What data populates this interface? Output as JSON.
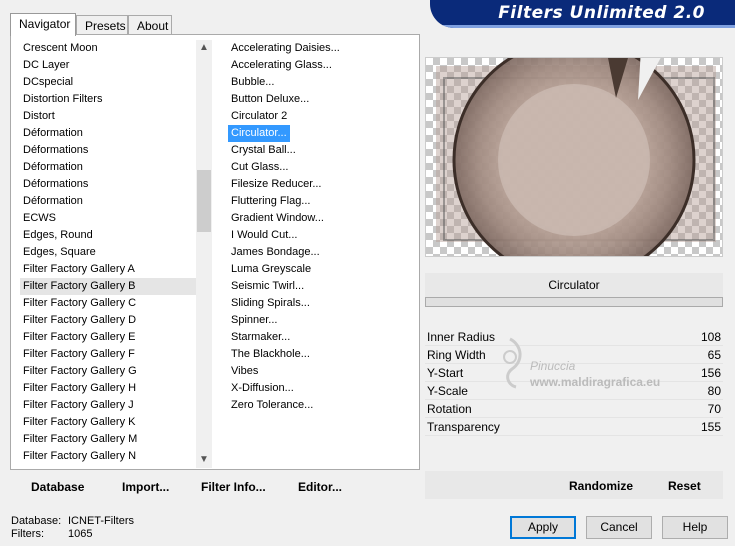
{
  "header": {
    "title": "Filters Unlimited 2.0"
  },
  "tabs": [
    {
      "label": "Navigator",
      "active": true
    },
    {
      "label": "Presets",
      "active": false
    },
    {
      "label": "About",
      "active": false
    }
  ],
  "categories": {
    "items": [
      "Crescent Moon",
      "DC Layer",
      "DCspecial",
      "Distortion Filters",
      "Distort",
      "Déformation",
      "Déformations",
      "Déformation",
      "Déformations",
      "Déformation",
      "ECWS",
      "Edges, Round",
      "Edges, Square",
      "Filter Factory Gallery A",
      "Filter Factory Gallery B",
      "Filter Factory Gallery C",
      "Filter Factory Gallery D",
      "Filter Factory Gallery E",
      "Filter Factory Gallery F",
      "Filter Factory Gallery G",
      "Filter Factory Gallery H",
      "Filter Factory Gallery J",
      "Filter Factory Gallery K",
      "Filter Factory Gallery M",
      "Filter Factory Gallery N"
    ],
    "selected": "Filter Factory Gallery B"
  },
  "filters": {
    "items": [
      "Accelerating Daisies...",
      "Accelerating Glass...",
      "Bubble...",
      "Button Deluxe...",
      "Circulator 2",
      "Circulator...",
      "Crystal Ball...",
      "Cut Glass...",
      "Filesize Reducer...",
      "Fluttering Flag...",
      "Gradient Window...",
      "I Would Cut...",
      "James Bondage...",
      "Luma Greyscale",
      "Seismic Twirl...",
      "Sliding Spirals...",
      "Spinner...",
      "Starmaker...",
      "The Blackhole...",
      "Vibes",
      "X-Diffusion...",
      "Zero Tolerance..."
    ],
    "selected": "Circulator..."
  },
  "left_buttons": {
    "database": "Database",
    "import": "Import...",
    "filter_info": "Filter Info...",
    "editor": "Editor..."
  },
  "current_filter": "Circulator",
  "params": [
    {
      "name": "Inner Radius",
      "value": "108"
    },
    {
      "name": "Ring Width",
      "value": "65"
    },
    {
      "name": "Y-Start",
      "value": "156"
    },
    {
      "name": "Y-Scale",
      "value": "80"
    },
    {
      "name": "Rotation",
      "value": "70"
    },
    {
      "name": "Transparency",
      "value": "155"
    }
  ],
  "watermark": {
    "name": "Pinuccia",
    "url": "www.maldiragrafica.eu"
  },
  "right_buttons": {
    "randomize": "Randomize",
    "reset": "Reset"
  },
  "status": {
    "database_label": "Database:",
    "database_value": "ICNET-Filters",
    "filters_label": "Filters:",
    "filters_value": "1065"
  },
  "dialog_buttons": {
    "apply": "Apply",
    "cancel": "Cancel",
    "help": "Help"
  }
}
